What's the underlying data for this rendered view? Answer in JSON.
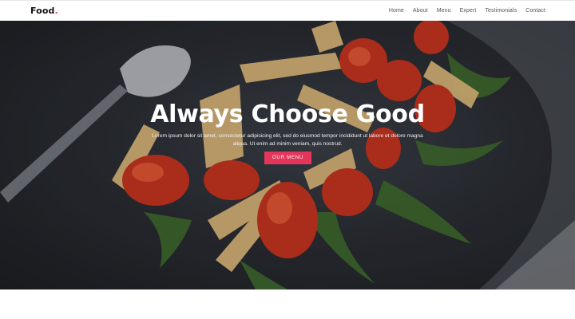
{
  "header": {
    "logo_text": "Food",
    "logo_dot": ".",
    "nav": [
      {
        "label": "Home"
      },
      {
        "label": "About"
      },
      {
        "label": "Menu"
      },
      {
        "label": "Expert"
      },
      {
        "label": "Testimonials"
      },
      {
        "label": "Contact"
      }
    ]
  },
  "hero": {
    "title": "Always Choose Good",
    "description": "Lorem ipsum dolor sit amet, consectetur adipisicing elit, sed do eiusmod tempor incididunt ut labore et dolore magna aliqua. Ut enim ad minim veniam, quis nostrud.",
    "button_label": "OUR MENU",
    "image": "pasta-with-cherry-tomatoes-photo"
  },
  "colors": {
    "accent": "#e3365a",
    "header_bg": "#ffffff",
    "nav_text": "#555555",
    "hero_text": "#ffffff"
  }
}
